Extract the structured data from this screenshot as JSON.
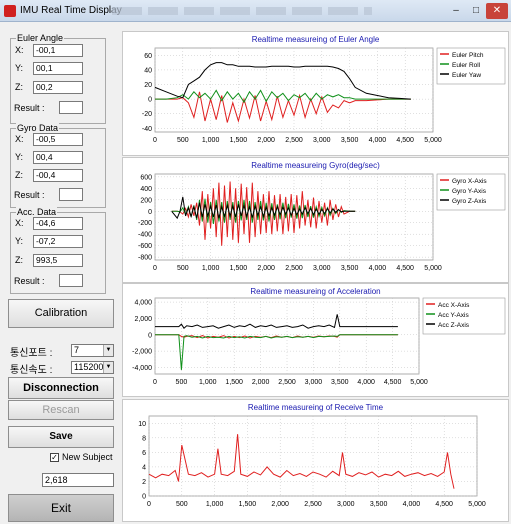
{
  "window": {
    "title": "IMU Real Time Display",
    "min": "–",
    "max": "□",
    "close": "✕"
  },
  "euler": {
    "title": "Euler Angle",
    "x_label": "X:",
    "x": "-00,1",
    "y_label": "Y:",
    "y": "00,1",
    "z_label": "Z:",
    "z": "00,2",
    "result_label": "Result :",
    "result": ""
  },
  "gyro": {
    "title": "Gyro Data",
    "x_label": "X:",
    "x": "-00,5",
    "y_label": "Y:",
    "y": "00,4",
    "z_label": "Z:",
    "z": "-00,4",
    "result_label": "Result :",
    "result": ""
  },
  "acc": {
    "title": "Acc. Data",
    "x_label": "X:",
    "x": "-04,6",
    "y_label": "Y:",
    "y": "-07,2",
    "z_label": "Z:",
    "z": "993,5",
    "result_label": "Result :",
    "result": ""
  },
  "controls": {
    "calibration": "Calibration",
    "port_label": "통신포트 :",
    "port_value": "7",
    "speed_label": "통신속도 :",
    "speed_value": "115200",
    "disconnection": "Disconnection",
    "rescan": "Rescan",
    "save": "Save",
    "new_subject": "New Subject",
    "new_subject_checked": true,
    "count": "2,618",
    "exit": "Exit"
  },
  "chart_data": [
    {
      "type": "line",
      "title": "Realtime measureing of Euler Angle",
      "xlim": [
        0,
        5000
      ],
      "ylim": [
        -45,
        70
      ],
      "xticks": [
        0,
        500,
        1000,
        1500,
        2000,
        2500,
        3000,
        3500,
        4000,
        4500,
        5000
      ],
      "yticks": [
        -40,
        -20,
        0,
        20,
        40,
        60
      ],
      "x": [
        0,
        200,
        400,
        500,
        600,
        700,
        800,
        900,
        1000,
        1100,
        1200,
        1300,
        1400,
        1500,
        1600,
        1700,
        1800,
        1900,
        2000,
        2100,
        2200,
        2300,
        2400,
        2500,
        2600,
        2700,
        2800,
        2900,
        3000,
        3100,
        3200,
        3300,
        3400,
        3500,
        3600,
        3800,
        4000,
        4200,
        4400,
        4600
      ],
      "series": [
        {
          "name": "Euler Pitch",
          "color": "#e02020",
          "values": [
            0,
            0,
            0,
            2,
            -5,
            -25,
            10,
            -30,
            0,
            -28,
            5,
            -32,
            -5,
            -30,
            0,
            -26,
            5,
            -30,
            -3,
            -28,
            4,
            -25,
            -2,
            -22,
            5,
            -25,
            0,
            -20,
            3,
            -18,
            -8,
            -12,
            -2,
            -5,
            -2,
            -2,
            -1,
            0,
            0,
            0
          ]
        },
        {
          "name": "Euler Roll",
          "color": "#10901a",
          "values": [
            0,
            0,
            2,
            6,
            0,
            10,
            2,
            8,
            0,
            12,
            -2,
            10,
            0,
            8,
            -4,
            10,
            0,
            12,
            -3,
            10,
            2,
            8,
            -2,
            6,
            2,
            8,
            -2,
            8,
            0,
            6,
            3,
            6,
            2,
            2,
            0,
            0,
            0,
            0,
            0,
            0
          ]
        },
        {
          "name": "Euler Yaw",
          "color": "#000000",
          "values": [
            16,
            10,
            4,
            2,
            20,
            25,
            30,
            40,
            47,
            50,
            50,
            47,
            47,
            45,
            45,
            45,
            44,
            44,
            44,
            45,
            45,
            45,
            45,
            44,
            44,
            45,
            45,
            45,
            45,
            45,
            44,
            42,
            38,
            28,
            16,
            8,
            5,
            2,
            1,
            0
          ]
        }
      ]
    },
    {
      "type": "line",
      "title": "Realtime measureing Gyro(deg/sec)",
      "xlim": [
        0,
        5000
      ],
      "ylim": [
        -850,
        650
      ],
      "xticks": [
        0,
        500,
        1000,
        1500,
        2000,
        2500,
        3000,
        3500,
        4000,
        4500,
        5000
      ],
      "yticks": [
        -800,
        -600,
        -400,
        -200,
        0,
        200,
        400,
        600
      ],
      "x": [
        300,
        400,
        450,
        500,
        550,
        600,
        650,
        700,
        750,
        800,
        850,
        900,
        950,
        1000,
        1050,
        1100,
        1150,
        1200,
        1250,
        1300,
        1350,
        1400,
        1450,
        1500,
        1550,
        1600,
        1650,
        1700,
        1750,
        1800,
        1850,
        1900,
        1950,
        2000,
        2050,
        2100,
        2150,
        2200,
        2250,
        2300,
        2350,
        2400,
        2450,
        2500,
        2550,
        2600,
        2650,
        2700,
        2750,
        2800,
        2850,
        2900,
        2950,
        3000,
        3050,
        3100,
        3150,
        3200,
        3250,
        3300,
        3350,
        3400,
        3500,
        3600
      ],
      "series": [
        {
          "name": "Gyro X-Axis",
          "color": "#e02020",
          "values": [
            0,
            0,
            -10,
            -50,
            50,
            -100,
            120,
            -80,
            150,
            -250,
            350,
            -500,
            300,
            -300,
            400,
            -450,
            500,
            -600,
            450,
            -450,
            520,
            -500,
            400,
            -550,
            480,
            -400,
            420,
            -550,
            500,
            -450,
            350,
            -400,
            300,
            -380,
            350,
            -400,
            280,
            -350,
            300,
            -400,
            250,
            -350,
            300,
            -380,
            280,
            -300,
            350,
            -250,
            200,
            -280,
            240,
            -300,
            180,
            -200,
            150,
            -250,
            200,
            -150,
            120,
            -100,
            80,
            -50,
            0,
            0
          ]
        },
        {
          "name": "Gyro Y-Axis",
          "color": "#10901a",
          "values": [
            0,
            0,
            -10,
            60,
            -60,
            80,
            -100,
            100,
            -150,
            200,
            -180,
            220,
            -200,
            160,
            -220,
            200,
            -180,
            160,
            -200,
            180,
            -150,
            160,
            -200,
            180,
            -160,
            200,
            -150,
            180,
            -200,
            160,
            -150,
            180,
            -160,
            150,
            -180,
            140,
            -150,
            120,
            -140,
            150,
            -120,
            130,
            -110,
            120,
            -130,
            100,
            -120,
            110,
            -100,
            90,
            -110,
            80,
            -90,
            70,
            -80,
            60,
            -70,
            50,
            -40,
            30,
            -20,
            10,
            0,
            0
          ]
        },
        {
          "name": "Gyro Z-Axis",
          "color": "#000000",
          "values": [
            0,
            -120,
            0,
            250,
            -80,
            60,
            -90,
            80,
            -120,
            150,
            -100,
            120,
            -80,
            90,
            -100,
            110,
            -120,
            80,
            -90,
            100,
            -80,
            90,
            -100,
            120,
            -80,
            100,
            -90,
            80,
            -110,
            90,
            -70,
            80,
            -90,
            70,
            -80,
            60,
            -70,
            80,
            -60,
            70,
            -50,
            60,
            -70,
            50,
            -60,
            40,
            -50,
            60,
            -40,
            50,
            -60,
            40,
            -50,
            30,
            -40,
            50,
            -30,
            40,
            -20,
            30,
            -10,
            0,
            0,
            0
          ]
        }
      ]
    },
    {
      "type": "line",
      "title": "Realtime measureing of Acceleration",
      "xlim": [
        0,
        5000
      ],
      "ylim": [
        -4800,
        4500
      ],
      "xticks": [
        0,
        500,
        1000,
        1500,
        2000,
        2500,
        3000,
        3500,
        4000,
        4500,
        5000
      ],
      "yticks": [
        -4000,
        -2000,
        0,
        2000,
        4000
      ],
      "x": [
        0,
        300,
        450,
        500,
        550,
        600,
        700,
        800,
        900,
        1000,
        1100,
        1200,
        1300,
        1400,
        1500,
        1600,
        1700,
        1800,
        1900,
        2000,
        2100,
        2200,
        2300,
        2400,
        2500,
        2600,
        2700,
        2800,
        2900,
        3000,
        3100,
        3200,
        3300,
        3400,
        3450,
        3500,
        3600,
        4000,
        4600
      ],
      "series": [
        {
          "name": "Acc X-Axis",
          "color": "#e02020",
          "values": [
            0,
            0,
            0,
            -200,
            -300,
            -200,
            -100,
            -350,
            -100,
            -400,
            -200,
            -300,
            -100,
            -400,
            -200,
            -350,
            -150,
            -400,
            -200,
            -300,
            -200,
            -350,
            -150,
            -300,
            -200,
            -350,
            -150,
            -300,
            -200,
            -300,
            -150,
            -250,
            -150,
            -200,
            -300,
            0,
            0,
            0,
            0
          ]
        },
        {
          "name": "Acc Y-Axis",
          "color": "#10901a",
          "values": [
            0,
            0,
            0,
            -4300,
            -200,
            -100,
            -300,
            -200,
            -400,
            -200,
            -350,
            -300,
            -400,
            -200,
            -350,
            -250,
            -400,
            -200,
            -300,
            -350,
            -200,
            -400,
            -250,
            -300,
            -200,
            -350,
            -250,
            -300,
            -200,
            -350,
            -200,
            -250,
            -200,
            -150,
            -200,
            0,
            0,
            0,
            0
          ]
        },
        {
          "name": "Acc Z-Axis",
          "color": "#000000",
          "values": [
            1000,
            1000,
            1000,
            1300,
            800,
            1100,
            1000,
            1200,
            900,
            1000,
            1100,
            800,
            1000,
            1200,
            900,
            1100,
            1000,
            1300,
            900,
            1100,
            1000,
            1200,
            900,
            1000,
            1100,
            900,
            1000,
            1200,
            800,
            1000,
            1100,
            1000,
            1200,
            900,
            2500,
            1000,
            1000,
            1000,
            1000
          ]
        }
      ]
    },
    {
      "type": "line",
      "title": "Realtime measureing of Receive Time",
      "xlim": [
        0,
        5000
      ],
      "ylim": [
        0,
        11
      ],
      "xticks": [
        0,
        500,
        1000,
        1500,
        2000,
        2500,
        3000,
        3500,
        4000,
        4500,
        5000
      ],
      "yticks": [
        0,
        2,
        4,
        6,
        8,
        10
      ],
      "x": [
        0,
        100,
        200,
        300,
        400,
        450,
        500,
        600,
        700,
        800,
        900,
        1000,
        1050,
        1100,
        1200,
        1300,
        1350,
        1400,
        1500,
        1600,
        1700,
        1800,
        1900,
        2000,
        2100,
        2200,
        2300,
        2400,
        2500,
        2600,
        2700,
        2800,
        2900,
        2950,
        3000,
        3100,
        3200,
        3300,
        3400,
        3500,
        3600,
        3700,
        3800,
        3900,
        4000,
        4100,
        4200,
        4300,
        4400,
        4500,
        4550,
        4600,
        4650
      ],
      "series": [
        {
          "name": "",
          "color": "#e02020",
          "values": [
            3,
            2.5,
            3,
            2.8,
            3.5,
            2,
            7,
            3,
            2.8,
            3.2,
            2.6,
            3,
            6.5,
            3,
            2.8,
            3.4,
            8.5,
            3,
            2.7,
            3.3,
            2.9,
            4,
            3,
            2.6,
            3.5,
            2.8,
            3.1,
            2.7,
            3.3,
            3,
            2.6,
            3.4,
            2.8,
            6,
            3,
            2.7,
            3.2,
            2.9,
            3.3,
            2.6,
            3,
            2.8,
            3.4,
            2.7,
            3,
            3.2,
            2.8,
            3.1,
            2.7,
            3.3,
            6,
            3,
            1
          ]
        }
      ]
    }
  ]
}
